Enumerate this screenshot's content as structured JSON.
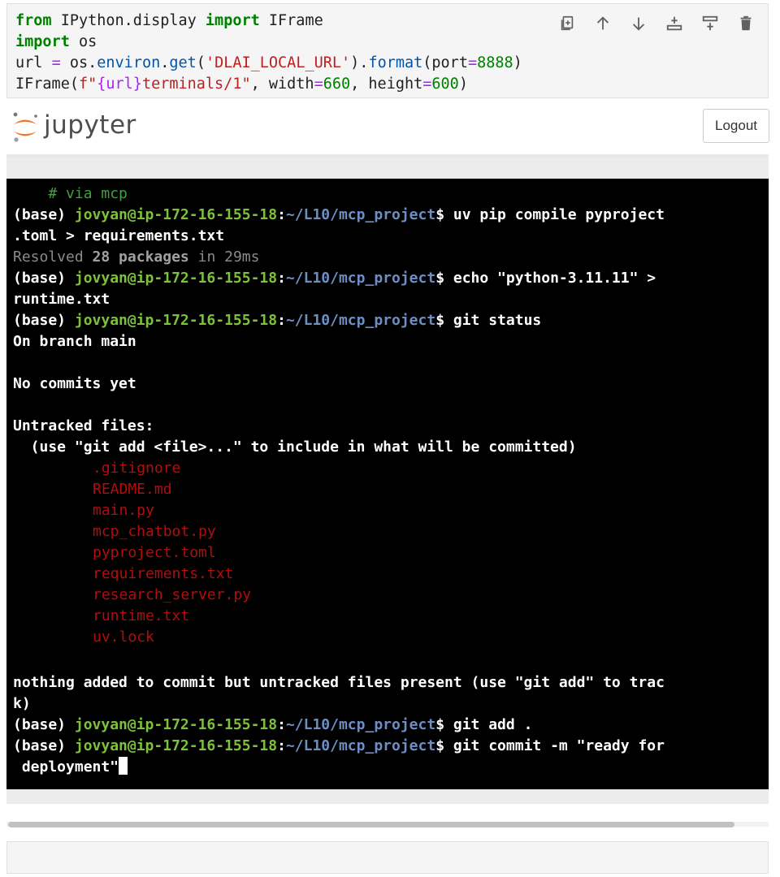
{
  "code_cell": {
    "line1": {
      "from": "from",
      "module": " IPython.display ",
      "import": "import",
      "name": " IFrame"
    },
    "line2": {
      "import": "import",
      "name": " os"
    },
    "line3": {
      "var": "url ",
      "eq": "=",
      "obj": " os.",
      "environ": "environ",
      "dot": ".",
      "get": "get",
      "open": "(",
      "str": "'DLAI_LOCAL_URL'",
      "close": ").",
      "format": "format",
      "open2": "(",
      "arg": "port",
      "eq2": "=",
      "num": "8888",
      "close2": ")"
    },
    "line4": {
      "fn": "IFrame(",
      "fpre": "f\"",
      "brace": "{url}",
      "fpost": "terminals/1\"",
      "sep1": ", width",
      "eq1": "=",
      "w": "660",
      "sep2": ", height",
      "eq2": "=",
      "h": "600",
      "end": ")"
    }
  },
  "toolbar": {
    "icons": [
      "duplicate-icon",
      "move-up-icon",
      "move-down-icon",
      "insert-above-icon",
      "insert-below-icon",
      "delete-icon"
    ]
  },
  "jupyter": {
    "logo_text": "jupyter",
    "logout_label": "Logout"
  },
  "terminal": {
    "comment": "    # via mcp",
    "prompt_base": "(base) ",
    "user_host": "jovyan@ip-172-16-155-18",
    "colon": ":",
    "path": "~/L10/mcp_project",
    "dollar": "$",
    "cmd1": " uv pip compile pyproject",
    "cmd1_wrap": ".toml > requirements.txt",
    "resolved_a": "Resolved ",
    "resolved_b": "28 packages",
    "resolved_c": " in 29ms",
    "cmd2": " echo \"python-3.11.11\" >",
    "cmd2_wrap": "runtime.txt",
    "cmd3": " git status",
    "on_branch": "On branch main",
    "no_commits": "No commits yet",
    "untracked": "Untracked files:",
    "hint": "  (use \"git add <file>...\" to include in what will be committed)",
    "files": [
      ".gitignore",
      "README.md",
      "main.py",
      "mcp_chatbot.py",
      "pyproject.toml",
      "requirements.txt",
      "research_server.py",
      "runtime.txt",
      "uv.lock"
    ],
    "nothing_added": "nothing added to commit but untracked files present (use \"git add\" to trac",
    "nothing_added_wrap": "k)",
    "cmd4": " git add .",
    "cmd5": " git commit -m \"ready for",
    "cmd5_wrap": " deployment\""
  }
}
